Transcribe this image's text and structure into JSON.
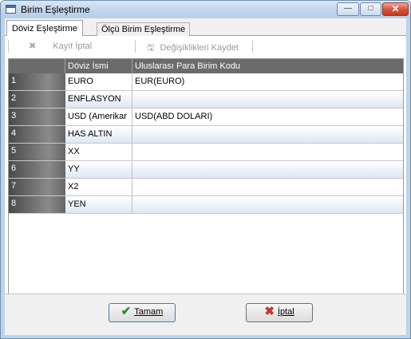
{
  "window": {
    "title": "Birim Eşleştirme",
    "minimize_glyph": "—",
    "maximize_glyph": "□",
    "close_glyph": "✕"
  },
  "tabs": [
    {
      "label": "Döviz Eşleştirme",
      "active": true
    },
    {
      "label": "Ölçü Birim Eşleştirme",
      "active": false
    }
  ],
  "toolbar": {
    "cancel_record": {
      "label": "Kayıt İptal",
      "icon": "x-icon",
      "glyph": "✖"
    },
    "save_changes": {
      "label": "Değişiklikleri Kaydet",
      "icon": "floppy-disk-icon",
      "glyph": "🖫"
    }
  },
  "grid": {
    "columns": [
      "",
      "Döviz İsmi",
      "Uluslarası Para Birim Kodu"
    ],
    "rows": [
      {
        "num": "1",
        "name": "EURO",
        "code": "EUR(EURO)"
      },
      {
        "num": "2",
        "name": "ENFLASYON",
        "code": ""
      },
      {
        "num": "3",
        "name": "USD (Amerikar",
        "code": "USD(ABD DOLARI)"
      },
      {
        "num": "4",
        "name": "HAS ALTIN",
        "code": ""
      },
      {
        "num": "5",
        "name": "XX",
        "code": ""
      },
      {
        "num": "6",
        "name": "YY",
        "code": ""
      },
      {
        "num": "7",
        "name": "X2",
        "code": ""
      },
      {
        "num": "8",
        "name": "YEN",
        "code": ""
      }
    ]
  },
  "scrollbar": {
    "left_arrow": "◀",
    "right_arrow": "▶"
  },
  "footer": {
    "ok_label": "Tamam",
    "ok_glyph": "✔",
    "cancel_label": "İptal",
    "cancel_glyph": "✖"
  },
  "colors": {
    "grid_header": "#6b6b6b",
    "row_alt": "#dde7f3",
    "accent": "#3c7fb1"
  }
}
